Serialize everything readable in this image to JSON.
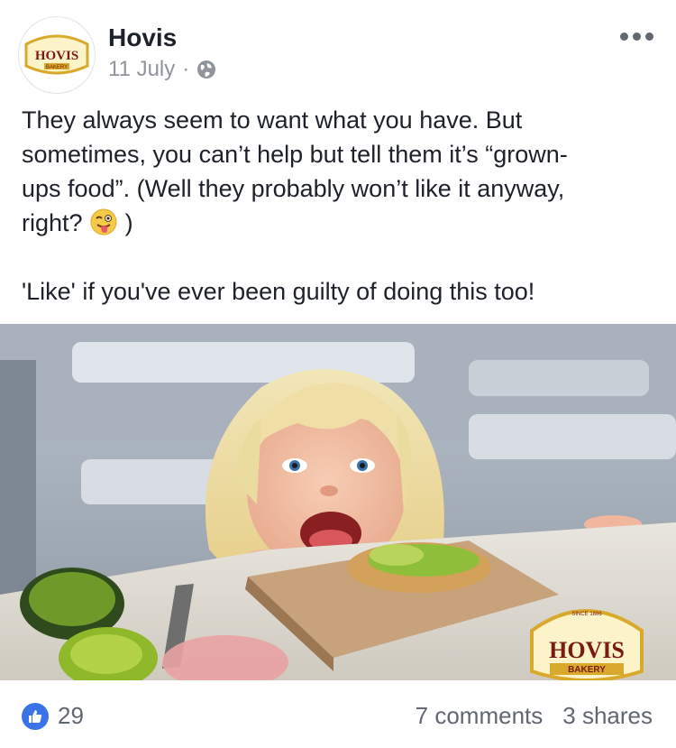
{
  "post": {
    "page_name": "Hovis",
    "date": "11 July",
    "separator": "·",
    "audience_icon": "globe-icon",
    "more_icon": "more-options-icon",
    "text": {
      "line1": "They always seem to want what you have. But",
      "line2": "sometimes, you can’t help but tell them it’s “grown-",
      "line3": "ups food”. (Well they probably won’t like it anyway,",
      "line4_start": "right?",
      "line4_end": ")",
      "line5": "'Like' if you've ever been guilty of doing this too!"
    },
    "emoji": "winking-tongue-face-emoji"
  },
  "logo": {
    "brand": "HOVIS",
    "sub": "BAKERY",
    "since": "SINCE 1886",
    "colors": {
      "gold": "#d8a92a",
      "cream": "#fdf3c9",
      "red": "#7a1a14"
    }
  },
  "footer": {
    "like_icon": "thumbs-up-icon",
    "like_count": "29",
    "comments": "7 comments",
    "shares": "3 shares"
  }
}
